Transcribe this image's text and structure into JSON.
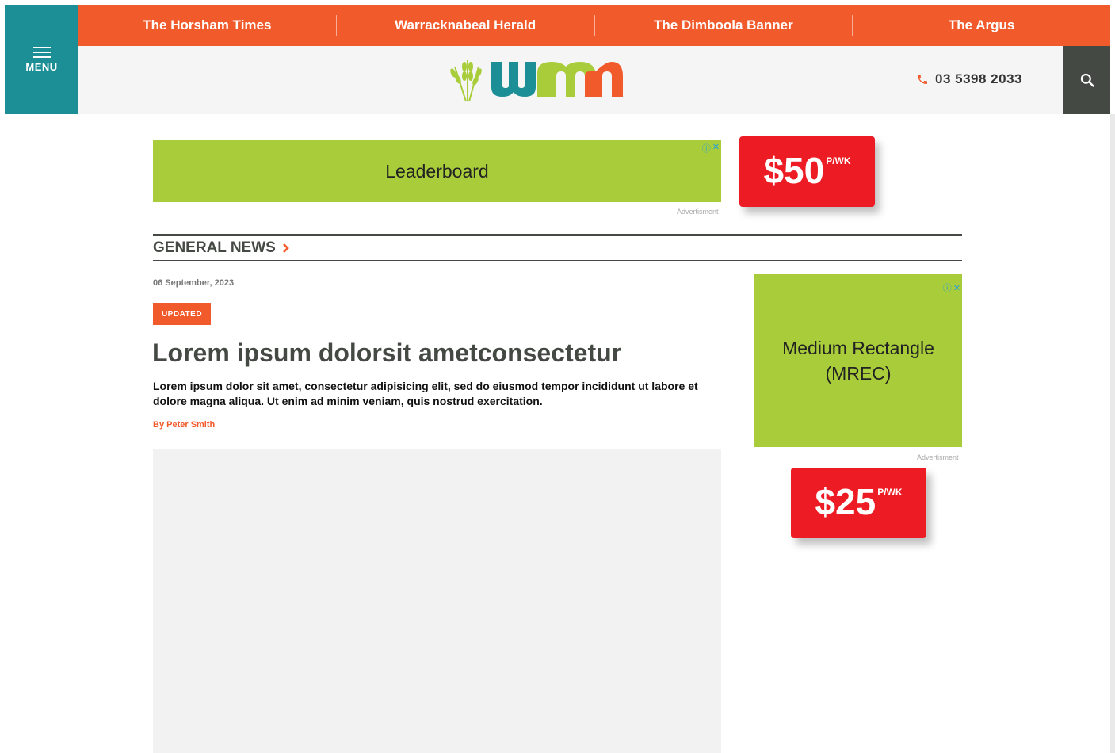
{
  "header": {
    "menu_label": "MENU",
    "nav": [
      {
        "label": "The Horsham Times"
      },
      {
        "label": "Warracknabeal Herald"
      },
      {
        "label": "The Dimboola Banner"
      },
      {
        "label": "The Argus"
      }
    ],
    "phone": "03 5398 2033"
  },
  "ads": {
    "leaderboard": {
      "label": "Leaderboard",
      "caption": "Advertisment",
      "price": "$50",
      "per": "P/WK"
    },
    "mrec": {
      "label_line1": "Medium Rectangle",
      "label_line2": "(MREC)",
      "caption": "Advertisment",
      "price": "$25",
      "per": "P/WK"
    }
  },
  "section": {
    "title": "GENERAL NEWS",
    "chevron": "›"
  },
  "article": {
    "date": "06 September, 2023",
    "badge": "UPDATED",
    "headline": "Lorem ipsum dolorsit ametconsectetur",
    "standfirst": "Lorem ipsum dolor sit amet, consectetur adipisicing elit, sed do eiusmod tempor incididunt ut labore et dolore magna aliqua. Ut enim ad minim veniam, quis nostrud exercitation.",
    "byline": "By Peter Smith"
  },
  "colors": {
    "brand_orange": "#f15a2b",
    "brand_teal": "#1c8f96",
    "ad_green": "#a9cd3a",
    "price_red": "#ed1c24",
    "dark_grey": "#444944"
  },
  "icons": {
    "menu": "hamburger-icon",
    "phone": "phone-icon",
    "search": "search-icon",
    "adchoices": "adchoices-icon",
    "close": "close-icon"
  }
}
